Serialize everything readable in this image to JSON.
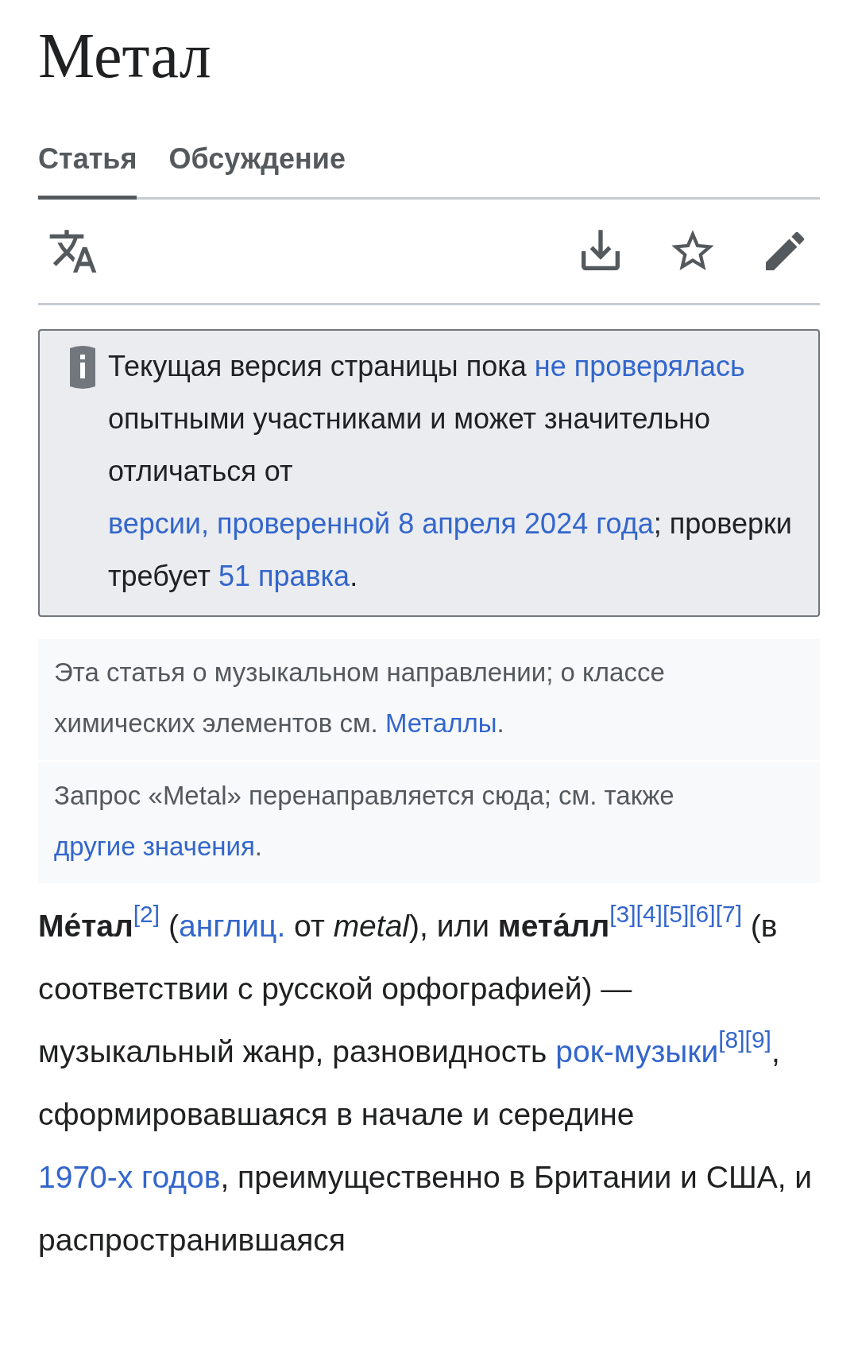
{
  "title": "Метал",
  "tabs": [
    {
      "label": "Статья",
      "selected": true
    },
    {
      "label": "Обсуждение",
      "selected": false
    }
  ],
  "notice": [
    {
      "kind": "text",
      "text": "Текущая версия страницы пока "
    },
    {
      "kind": "link",
      "text": "не проверялась"
    },
    {
      "kind": "text",
      "text": " опытными участниками и может значительно отличаться от "
    },
    {
      "kind": "link",
      "text": "версии, проверенной 8 апреля 2024 года"
    },
    {
      "kind": "text",
      "text": "; проверки требует "
    },
    {
      "kind": "link",
      "text": "51 правка"
    },
    {
      "kind": "text",
      "text": "."
    }
  ],
  "hatnotes": [
    [
      {
        "kind": "text",
        "text": "Эта статья о музыкальном направлении; о классе химических элементов см. "
      },
      {
        "kind": "link",
        "text": "Металлы"
      },
      {
        "kind": "text",
        "text": "."
      }
    ],
    [
      {
        "kind": "text",
        "text": "Запрос «Metal» перенаправляется сюда; см. также "
      },
      {
        "kind": "link",
        "text": "другие значения"
      },
      {
        "kind": "text",
        "text": "."
      }
    ]
  ],
  "paragraph": [
    {
      "kind": "bold",
      "text": "Ме́тал"
    },
    {
      "kind": "ref",
      "text": "[2]"
    },
    {
      "kind": "text",
      "text": " ("
    },
    {
      "kind": "link",
      "text": "англиц."
    },
    {
      "kind": "text",
      "text": " от "
    },
    {
      "kind": "italic",
      "text": "metal"
    },
    {
      "kind": "text",
      "text": "), или "
    },
    {
      "kind": "bold",
      "text": "мета́лл"
    },
    {
      "kind": "ref",
      "text": "[3]"
    },
    {
      "kind": "ref",
      "text": "[4]"
    },
    {
      "kind": "ref",
      "text": "[5]"
    },
    {
      "kind": "ref",
      "text": "[6]"
    },
    {
      "kind": "ref",
      "text": "[7]"
    },
    {
      "kind": "text",
      "text": " (в соответствии с русской орфографией) — музыкальный жанр, разновидность "
    },
    {
      "kind": "link",
      "text": "рок-музыки"
    },
    {
      "kind": "ref",
      "text": "[8]"
    },
    {
      "kind": "ref",
      "text": "[9]"
    },
    {
      "kind": "text",
      "text": ", сформировавшаяся в начале и середине "
    },
    {
      "kind": "link",
      "text": "1970-х годов"
    },
    {
      "kind": "text",
      "text": ", преимущественно в Британии и США, и распространившаяся"
    }
  ]
}
